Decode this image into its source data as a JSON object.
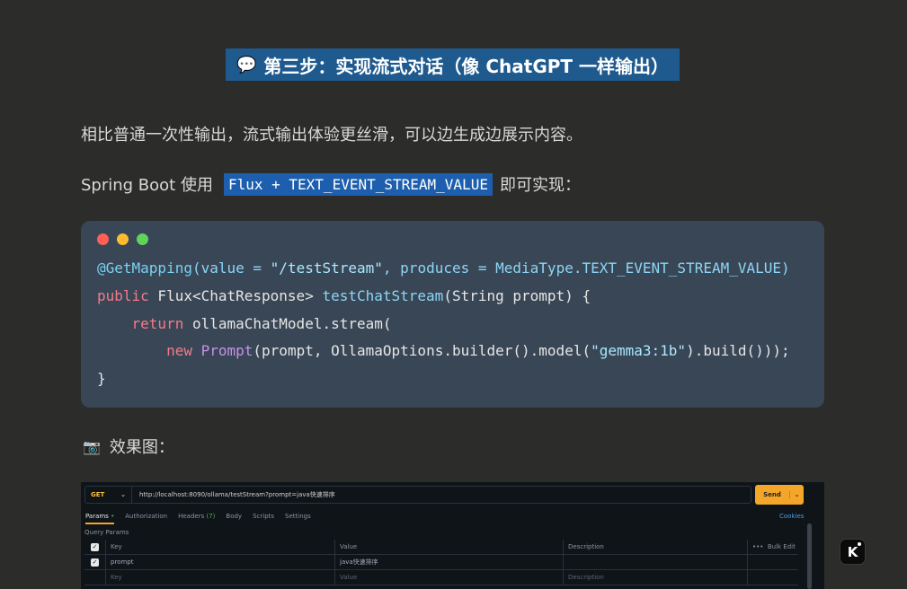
{
  "heading": {
    "icon": "speech-bubble-icon",
    "glyph": "💬",
    "text": "第三步：实现流式对话（像 ChatGPT 一样输出）"
  },
  "para1": "相比普通一次性输出，流式输出体验更丝滑，可以边生成边展示内容。",
  "para2": {
    "prefix": "Spring Boot 使用",
    "highlight": "Flux + TEXT_EVENT_STREAM_VALUE",
    "suffix": "即可实现："
  },
  "code": {
    "line1": {
      "ann": "@GetMapping",
      "rest1": "(value = ",
      "str1": "\"/testStream\"",
      "rest2": ", produces = MediaType.TEXT_EVENT_STREAM_VALUE)"
    },
    "line2": {
      "kw": "public",
      "rest1": " Flux<ChatResponse> ",
      "fn": "testChatStream",
      "rest2": "(String prompt) {"
    },
    "line3": {
      "indent": "    ",
      "kw": "return",
      "rest": " ollamaChatModel.stream("
    },
    "line4": {
      "indent": "        ",
      "kw": "new",
      "sp": " ",
      "cls": "Prompt",
      "rest1": "(prompt, OllamaOptions.builder().model(",
      "str": "\"gemma3:1b\"",
      "rest2": ").build()));"
    },
    "line5": "}"
  },
  "effect": {
    "icon": "camera-icon",
    "glyph": "📷",
    "text": "效果图："
  },
  "screenshot": {
    "method": "GET",
    "url": "http://localhost:8090/ollama/testStream?prompt=java快速排序",
    "send": "Send",
    "tabs": {
      "params": "Params",
      "params_dot": "•",
      "authorization": "Authorization",
      "headers": "Headers",
      "headers_count": "(7)",
      "body": "Body",
      "scripts": "Scripts",
      "settings": "Settings"
    },
    "cookies": "Cookies",
    "query_params": "Query Params",
    "columns": {
      "key": "Key",
      "value": "Value",
      "description": "Description",
      "more": "•••",
      "bulk_edit": "Bulk Edit"
    },
    "row1": {
      "key": "prompt",
      "value": "java快速排序"
    },
    "placeholder": {
      "key": "Key",
      "value": "Value",
      "description": "Description"
    }
  },
  "logo": {
    "letter": "K"
  }
}
